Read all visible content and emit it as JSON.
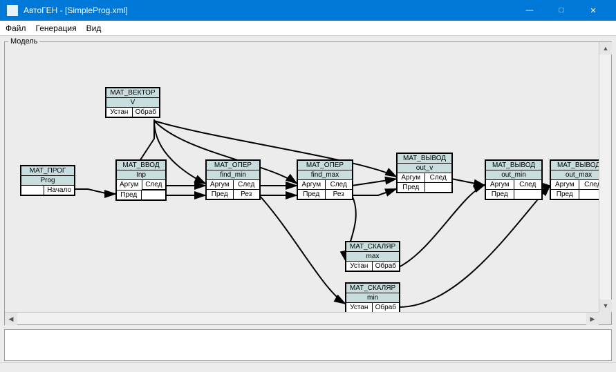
{
  "window": {
    "title": "АвтоГЕН - [SimpleProg.xml]"
  },
  "menu": {
    "file": "Файл",
    "generation": "Генерация",
    "view": "Вид"
  },
  "workspace": {
    "fieldset_label": "Модель"
  },
  "nodes": {
    "prog": {
      "title": "МАТ_ПРОГ",
      "name": "Prog",
      "p1": "",
      "p2": "Начало"
    },
    "vector": {
      "title": "МАТ_ВЕКТОР",
      "name": "V",
      "p1": "Устан",
      "p2": "Обраб"
    },
    "input": {
      "title": "МАТ_ВВОД",
      "name": "Inp",
      "p1a": "Аргум",
      "p1b": "След",
      "p2a": "Пред",
      "p2b": ""
    },
    "opmin": {
      "title": "МАТ_ОПЕР",
      "name": "find_min",
      "p1a": "Аргум",
      "p1b": "След",
      "p2a": "Пред",
      "p2b": "Рез"
    },
    "opmax": {
      "title": "МАТ_ОПЕР",
      "name": "find_max",
      "p1a": "Аргум",
      "p1b": "След",
      "p2a": "Пред",
      "p2b": "Рез"
    },
    "outv": {
      "title": "МАТ_ВЫВОД",
      "name": "out_v",
      "p1a": "Аргум",
      "p1b": "След",
      "p2a": "Пред",
      "p2b": ""
    },
    "outmin": {
      "title": "МАТ_ВЫВОД",
      "name": "out_min",
      "p1a": "Аргум",
      "p1b": "След",
      "p2a": "Пред",
      "p2b": ""
    },
    "outmax": {
      "title": "МАТ_ВЫВОД",
      "name": "out_max",
      "p1a": "Аргум",
      "p1b": "След",
      "p2a": "Пред",
      "p2b": ""
    },
    "scmax": {
      "title": "МАТ_СКАЛЯР",
      "name": "max",
      "p1": "Устан",
      "p2": "Обраб"
    },
    "scmin": {
      "title": "МАТ_СКАЛЯР",
      "name": "min",
      "p1": "Устан",
      "p2": "Обраб"
    }
  }
}
